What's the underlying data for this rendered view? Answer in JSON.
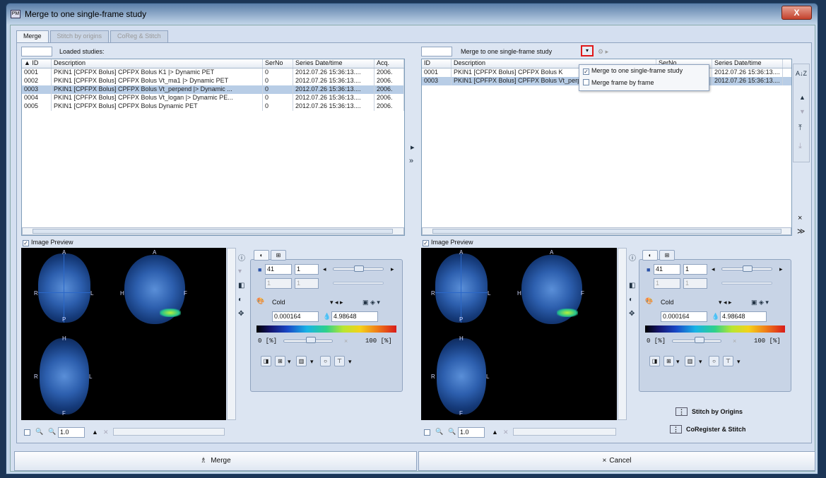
{
  "window": {
    "title": "Merge to one single-frame study",
    "close_label": "X"
  },
  "tabs": [
    {
      "label": "Merge",
      "active": true
    },
    {
      "label": "Stitch by origins",
      "active": false
    },
    {
      "label": "CoReg & Stitch",
      "active": false
    }
  ],
  "left": {
    "header_label": "Loaded studies:",
    "columns": [
      "▲ ID",
      "Description",
      "SerNo",
      "Series Date/time",
      "Acq."
    ],
    "rows": [
      [
        "0001",
        "PKIN1 [CPFPX Bolus] CPFPX Bolus K1 |> Dynamic PET",
        "0",
        "2012.07.26 15:36:13....",
        "2006."
      ],
      [
        "0002",
        "PKIN1 [CPFPX Bolus] CPFPX Bolus Vt_ma1 |> Dynamic PET",
        "0",
        "2012.07.26 15:36:13....",
        "2006."
      ],
      [
        "0003",
        "PKIN1 [CPFPX Bolus] CPFPX Bolus Vt_perpend |> Dynamic ...",
        "0",
        "2012.07.26 15:36:13....",
        "2006."
      ],
      [
        "0004",
        "PKIN1 [CPFPX Bolus] CPFPX Bolus Vt_logan |> Dynamic PE...",
        "0",
        "2012.07.26 15:36:13....",
        "2006."
      ],
      [
        "0005",
        "PKIN1 [CPFPX Bolus] CPFPX Bolus Dynamic PET",
        "0",
        "2012.07.26 15:36:13....",
        "2006."
      ]
    ],
    "selected_row": 2,
    "preview_label": "Image Preview"
  },
  "right": {
    "mode_label": "Merge to one single-frame study",
    "columns": [
      "ID",
      "Description",
      "SerNo",
      "Series Date/time"
    ],
    "rows": [
      [
        "0001",
        "PKIN1 [CPFPX Bolus] CPFPX Bolus K",
        "",
        "2012.07.26 15:36:13...."
      ],
      [
        "0003",
        "PKIN1 [CPFPX Bolus] CPFPX Bolus Vt_perpend |> Dynamic PET",
        "0",
        "2012.07.26 15:36:13...."
      ]
    ],
    "selected_row": 1,
    "preview_label": "Image Preview",
    "menu": [
      {
        "label": "Merge to one single-frame study",
        "checked": true
      },
      {
        "label": "Merge frame by frame",
        "checked": false
      }
    ],
    "stitch_origins": "Stitch by Origins",
    "coreg_stitch": "CoRegister & Stitch"
  },
  "viewer": {
    "slice": "41",
    "frame": "1",
    "frame2": "1",
    "frame3": "1",
    "colormap": "Cold",
    "min": "0.000164",
    "max": "4.98648",
    "pct_low": "0 [%]",
    "pct_high": "100 [%]",
    "zoom": "1.0",
    "cross": "×",
    "orient": {
      "A": "A",
      "P": "P",
      "R": "R",
      "L": "L",
      "H": "H",
      "F": "F"
    },
    "upper_pct": 0.55
  },
  "buttons": {
    "merge": "Merge",
    "cancel": "Cancel",
    "cancel_x": "×"
  },
  "icons": {
    "add_one": "▸",
    "add_all": "»",
    "remove_one": "×",
    "remove_all": "≫",
    "sort": "A↓Z",
    "up": "▲",
    "down": "▼",
    "top": "⤒",
    "bottom": "⤓"
  }
}
